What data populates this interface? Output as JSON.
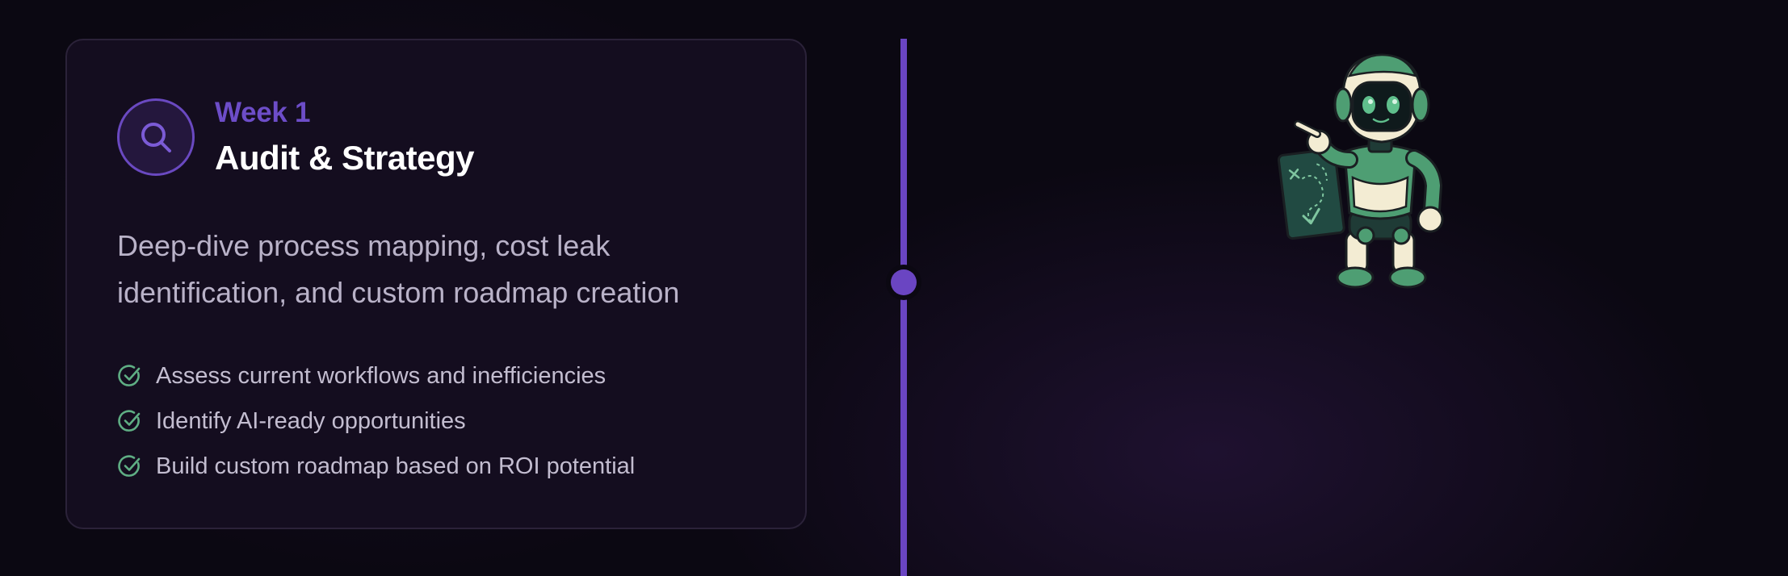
{
  "step": {
    "week_label": "Week 1",
    "title": "Audit & Strategy",
    "description": "Deep-dive process mapping, cost leak identification, and custom roadmap creation",
    "icon": "search-icon",
    "checklist": [
      "Assess current workflows and inefficiencies",
      "Identify AI-ready opportunities",
      "Build custom roadmap based on ROI potential"
    ]
  },
  "colors": {
    "accent": "#6a45c2",
    "week_label": "#6d4dc8",
    "check": "#5fae84",
    "background": "#0b0812",
    "card": "#140d1f"
  },
  "illustration": {
    "icon": "robot-with-map-icon"
  }
}
